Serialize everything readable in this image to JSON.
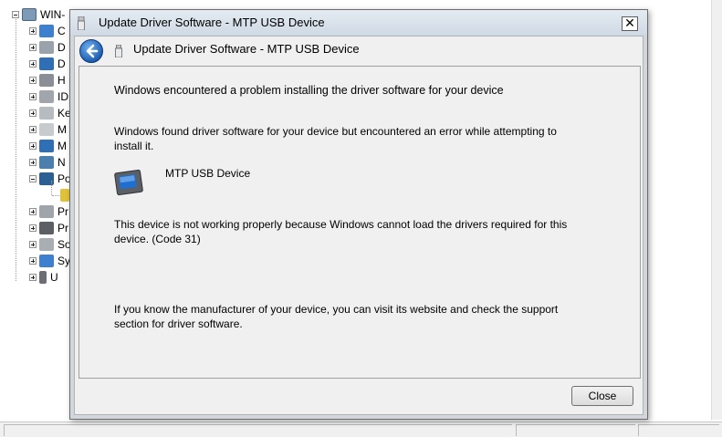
{
  "background": {
    "tree": {
      "root_label": "WIN-",
      "items": [
        {
          "label": "C"
        },
        {
          "label": "D"
        },
        {
          "label": "D"
        },
        {
          "label": "H"
        },
        {
          "label": "ID"
        },
        {
          "label": "Ke"
        },
        {
          "label": "M"
        },
        {
          "label": "M"
        },
        {
          "label": "N"
        },
        {
          "label": "Po"
        },
        {
          "label": ""
        },
        {
          "label": "Pr"
        },
        {
          "label": "Pr"
        },
        {
          "label": "So"
        },
        {
          "label": "Sy"
        },
        {
          "label": "U"
        }
      ]
    }
  },
  "dialog": {
    "title": "Update Driver Software - MTP USB Device",
    "close_glyph": "✕",
    "nav_title": "Update Driver Software - MTP USB Device",
    "heading": "Windows encountered a problem installing the driver software for your device",
    "message1": "Windows found driver software for your device but encountered an error while attempting to install it.",
    "device_name": "MTP USB Device",
    "message2": "This device is not working properly because Windows cannot load the drivers required for this device. (Code 31)",
    "message3": "If you know the manufacturer of your device, you can visit its website and check the support section for driver software.",
    "close_label": "Close"
  },
  "icons": {
    "back": "back-arrow-icon",
    "device": "portable-device-icon",
    "close": "close-icon"
  },
  "colors": {
    "titlebar": "#d6e0ea",
    "client_bg": "#f0f0f0",
    "back_button": "#2a6cc0"
  }
}
